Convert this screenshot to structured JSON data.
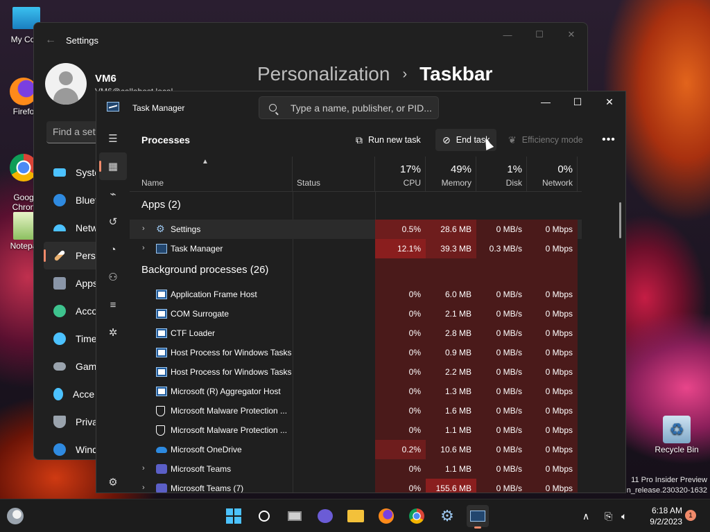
{
  "desktop": {
    "icons": [
      {
        "label": "My Com"
      },
      {
        "label": "Firefo"
      },
      {
        "label": "Goog\nChron"
      },
      {
        "label": "Notepa"
      },
      {
        "label": "Recycle Bin"
      }
    ],
    "watermark_line1": "11 Pro Insider Preview",
    "watermark_line2": "n_release.230320-1632"
  },
  "settings": {
    "app_title": "Settings",
    "user_name": "VM6",
    "user_email": "VM6@callahost.local",
    "breadcrumb_parent": "Personalization",
    "breadcrumb_separator": "›",
    "breadcrumb_current": "Taskbar",
    "search_placeholder": "Find a setti",
    "nav": [
      {
        "label": "Syste",
        "color": "#4cc2ff"
      },
      {
        "label": "Bluet",
        "color": "#2f8ae0"
      },
      {
        "label": "Netw",
        "color": "#4cc2ff"
      },
      {
        "label": "Perso",
        "color": "#e8b070"
      },
      {
        "label": "Apps",
        "color": "#8a96a8"
      },
      {
        "label": "Acco",
        "color": "#3ec38e"
      },
      {
        "label": "Time",
        "color": "#4cc2ff"
      },
      {
        "label": "Gam",
        "color": "#9aa3ad"
      },
      {
        "label": "Acce",
        "color": "#4cc2ff"
      },
      {
        "label": "Priva",
        "color": "#9aa3ad"
      },
      {
        "label": "Wind",
        "color": "#2f8ae0"
      }
    ]
  },
  "task_manager": {
    "title": "Task Manager",
    "search_placeholder": "Type a name, publisher, or PID...",
    "page_title": "Processes",
    "toolbar": {
      "run_new_task": "Run new task",
      "end_task": "End task",
      "efficiency_mode": "Efficiency mode",
      "more": "•••"
    },
    "columns": {
      "name": "Name",
      "status": "Status",
      "cpu_pct": "17%",
      "cpu": "CPU",
      "memory_pct": "49%",
      "memory": "Memory",
      "disk_pct": "1%",
      "disk": "Disk",
      "network_pct": "0%",
      "network": "Network"
    },
    "groups": {
      "apps": "Apps (2)",
      "background": "Background processes (26)"
    },
    "apps": [
      {
        "name": "Settings",
        "cpu": "0.5%",
        "memory": "28.6 MB",
        "disk": "0 MB/s",
        "network": "0 Mbps",
        "icon": "settings-gear-icon",
        "expand": "›"
      },
      {
        "name": "Task Manager",
        "cpu": "12.1%",
        "memory": "39.3 MB",
        "disk": "0.3 MB/s",
        "network": "0 Mbps",
        "icon": "task-manager-icon",
        "expand": "›"
      }
    ],
    "background": [
      {
        "name": "Application Frame Host",
        "cpu": "0%",
        "memory": "6.0 MB",
        "disk": "0 MB/s",
        "network": "0 Mbps",
        "icon": "window-frame-icon",
        "expand": ""
      },
      {
        "name": "COM Surrogate",
        "cpu": "0%",
        "memory": "2.1 MB",
        "disk": "0 MB/s",
        "network": "0 Mbps",
        "icon": "window-frame-icon",
        "expand": ""
      },
      {
        "name": "CTF Loader",
        "cpu": "0%",
        "memory": "2.8 MB",
        "disk": "0 MB/s",
        "network": "0 Mbps",
        "icon": "window-frame-icon",
        "expand": ""
      },
      {
        "name": "Host Process for Windows Tasks",
        "cpu": "0%",
        "memory": "0.9 MB",
        "disk": "0 MB/s",
        "network": "0 Mbps",
        "icon": "window-frame-icon",
        "expand": ""
      },
      {
        "name": "Host Process for Windows Tasks",
        "cpu": "0%",
        "memory": "2.2 MB",
        "disk": "0 MB/s",
        "network": "0 Mbps",
        "icon": "window-frame-icon",
        "expand": ""
      },
      {
        "name": "Microsoft (R) Aggregator Host",
        "cpu": "0%",
        "memory": "1.3 MB",
        "disk": "0 MB/s",
        "network": "0 Mbps",
        "icon": "window-frame-icon",
        "expand": ""
      },
      {
        "name": "Microsoft Malware Protection ...",
        "cpu": "0%",
        "memory": "1.6 MB",
        "disk": "0 MB/s",
        "network": "0 Mbps",
        "icon": "shield-icon",
        "expand": ""
      },
      {
        "name": "Microsoft Malware Protection ...",
        "cpu": "0%",
        "memory": "1.1 MB",
        "disk": "0 MB/s",
        "network": "0 Mbps",
        "icon": "shield-icon",
        "expand": ""
      },
      {
        "name": "Microsoft OneDrive",
        "cpu": "0.2%",
        "memory": "10.6 MB",
        "disk": "0 MB/s",
        "network": "0 Mbps",
        "icon": "onedrive-cloud-icon",
        "expand": ""
      },
      {
        "name": "Microsoft Teams",
        "cpu": "0%",
        "memory": "1.1 MB",
        "disk": "0 MB/s",
        "network": "0 Mbps",
        "icon": "teams-icon",
        "expand": "›"
      },
      {
        "name": "Microsoft Teams (7)",
        "cpu": "0%",
        "memory": "155.6 MB",
        "disk": "0 MB/s",
        "network": "0 Mbps",
        "icon": "teams-icon",
        "expand": "›"
      }
    ],
    "heat_colors": {
      "low": "#4a1a1a",
      "mid": "#6e1d1d",
      "high": "#8a1e1e",
      "row_hover": "#2b2b2b"
    }
  },
  "taskbar": {
    "time": "6:18 AM",
    "date": "9/2/2023",
    "notification_count": "1",
    "chevron": "∧"
  }
}
